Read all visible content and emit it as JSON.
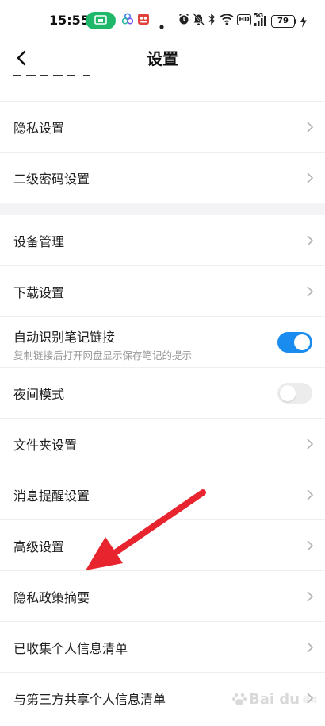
{
  "status_bar": {
    "time": "15:55",
    "battery": "79",
    "icons": [
      "screen-cast-icon",
      "app-clover-icon",
      "app-red-badge-icon",
      "dot-icon",
      "alarm-icon",
      "mute-bell-icon",
      "bluetooth-icon",
      "wifi-icon",
      "hd-icon",
      "signal-5g-icon",
      "charging-icon"
    ],
    "hd_label": "HD",
    "net_label": "5G",
    "colors": {
      "cast_pill": "#1fb86b",
      "red_badge": "#e0413a"
    }
  },
  "header": {
    "title": "设置",
    "back_icon": "chevron-left-icon"
  },
  "list": {
    "items": [
      {
        "label": "隐私设置",
        "type": "chevron"
      },
      {
        "label": "二级密码设置",
        "type": "chevron"
      },
      {
        "label": "设备管理",
        "type": "chevron"
      },
      {
        "label": "下载设置",
        "type": "chevron"
      },
      {
        "label": "自动识别笔记链接",
        "sublabel": "复制链接后打开网盘显示保存笔记的提示",
        "type": "toggle",
        "on": true
      },
      {
        "label": "夜间模式",
        "type": "toggle",
        "on": false
      },
      {
        "label": "文件夹设置",
        "type": "chevron"
      },
      {
        "label": "消息提醒设置",
        "type": "chevron"
      },
      {
        "label": "高级设置",
        "type": "chevron"
      },
      {
        "label": "隐私政策摘要",
        "type": "chevron"
      },
      {
        "label": "已收集个人信息清单",
        "type": "chevron"
      },
      {
        "label": "与第三方共享个人信息清单",
        "type": "chevron"
      }
    ]
  },
  "annotation": {
    "type": "red-arrow",
    "color": "#e8242e"
  },
  "watermark": {
    "text": "Bai du",
    "sub": "经验"
  },
  "colors": {
    "accent": "#1a8cf0",
    "divider": "#efefef",
    "section_gap": "#f3f3f5",
    "chevron": "#b4b4b4",
    "sublabel": "#999999"
  }
}
